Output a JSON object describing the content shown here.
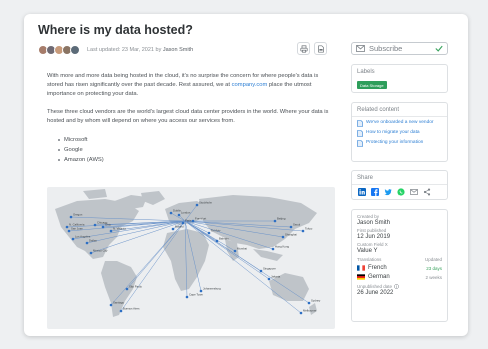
{
  "article": {
    "title": "Where is my data hosted?",
    "updated_prefix": "Last updated: ",
    "updated_date": "23 Mar, 2021",
    "updated_by_prefix": " by ",
    "author": "Jason Smith",
    "para1_a": "With more and more data being hosted in the cloud, it's no surprise the concern for where people's data is stored has risen significantly over the past decade. Rest assured, we at ",
    "para1_link": "company.com",
    "para1_b": " place the utmost importance on protecting your data.",
    "para2": "These three cloud vendors are the world's largest cloud data center providers in the world. Where your data is hosted and by whom will depend on where you access our services from.",
    "vendors": [
      "Microsoft",
      "Google",
      "Amazon (AWS)"
    ]
  },
  "map": {
    "cities": [
      "Oregon",
      "N. California",
      "San Jose",
      "Los Angeles",
      "Chicago",
      "Ohio",
      "N. Virginia",
      "Mexico City",
      "Dallas",
      "Santiago",
      "São Paulo",
      "Buenos Aires",
      "Dublin",
      "London",
      "Paris",
      "Frankfurt",
      "Stockholm",
      "Madrid",
      "Cape Town",
      "Johannesburg",
      "Mumbai",
      "Singapore",
      "Hong Kong",
      "Tokyo",
      "Seoul",
      "Beijing",
      "Shanghai",
      "Sydney",
      "Melbourne",
      "Jakarta",
      "Bahrain",
      "Tel Aviv"
    ]
  },
  "sidebar": {
    "subscribe_label": "Subscribe",
    "labels_title": "Labels",
    "labels": [
      "Data Storage"
    ],
    "related_title": "Related content",
    "related": [
      "We've onboarded a new vendor",
      "How to migrate your data",
      "Protecting your information"
    ],
    "share_title": "Share",
    "share_icons": [
      "linkedin-icon",
      "facebook-icon",
      "twitter-icon",
      "whatsapp-icon",
      "email-icon",
      "share-icon"
    ],
    "created_by_label": "Created by",
    "created_by": "Jason Smith",
    "first_published_label": "First published",
    "first_published": "12 Jun 2019",
    "custom_field_label": "Custom Field X",
    "custom_field_value": "Value Y",
    "translations_label": "Translations",
    "updated_label": "Updated",
    "translations": [
      {
        "lang": "French",
        "ago": "23 days",
        "flag": "flag-france-icon"
      },
      {
        "lang": "German",
        "ago": "2 weeks",
        "flag": "flag-germany-icon"
      }
    ],
    "unpublished_label": "Unpublished date",
    "unpublished_date": "26 June 2022"
  },
  "colors": {
    "accent": "#2d7fd4",
    "tag": "#2e9e5b",
    "check": "#3aa35f"
  }
}
